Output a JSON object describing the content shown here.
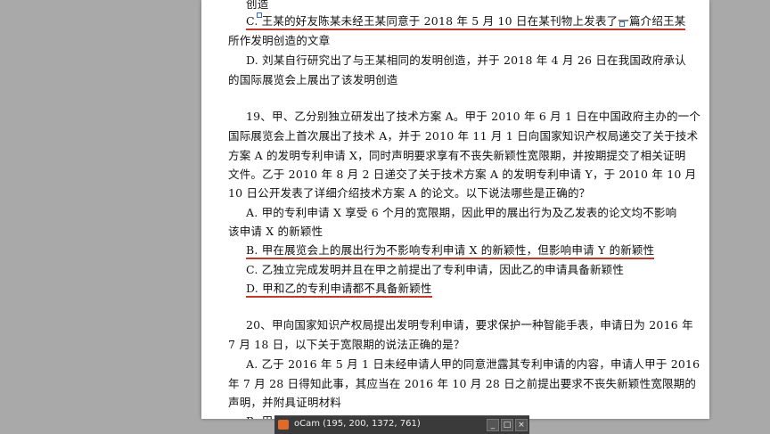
{
  "document": {
    "lines": [
      "创造",
      "C. 王某的好友陈某未经王某同意于 2018 年 5 月 10 日在某刊物上发表了一篇介绍王某",
      "所作发明创造的文章",
      "D. 刘某自行研究出了与王某相同的发明创造，并于 2018 年 4 月 26 日在我国政府承认",
      "的国际展览会上展出了该发明创造",
      "19、甲、乙分别独立研发出了技术方案 A。甲于 2010 年 6 月 1 日在中国政府主办的一个",
      "国际展览会上首次展出了技术 A，并于 2010 年 11 月 1 日向国家知识产权局递交了关于技术",
      "方案 A 的发明专利申请 X，同时声明要求享有不丧失新颖性宽限期，并按期提交了相关证明",
      "文件。乙于 2010 年 8 月 2 日递交了关于技术方案 A 的发明专利申请 Y，于 2010 年 10 月",
      "10 日公开发表了详细介绍技术方案 A 的论文。以下说法哪些是正确的？",
      "A. 甲的专利申请 X 享受 6 个月的宽限期，因此甲的展出行为及乙发表的论文均不影响",
      "该申请 X 的新颖性",
      "B. 甲在展览会上的展出行为不影响专利申请 X 的新颖性，但影响申请 Y 的新颖性",
      "C. 乙独立完成发明并且在甲之前提出了专利申请，因此乙的申请具备新颖性",
      "D. 甲和乙的专利申请都不具备新颖性",
      "20、甲向国家知识产权局提出发明专利申请，要求保护一种智能手表，申请日为 2016 年",
      "7 月 18 日，以下关于宽限期的说法正确的是？",
      "A. 乙于 2016 年 5 月 1 日未经申请人甲的同意泄露其专利申请的内容，申请人甲于 2016",
      "年 7 月 28 日得知此事，其应当在 2016 年 10 月 28 日之前提出要求不丧失新颖性宽限期的",
      "声明，并附具证明材料",
      "B. 甲于 ... 该智能手表的技术方"
    ]
  },
  "taskbar": {
    "title": "oCam (195, 200, 1372, 761)",
    "minimize": "_",
    "maximize": "□",
    "close": "×"
  }
}
